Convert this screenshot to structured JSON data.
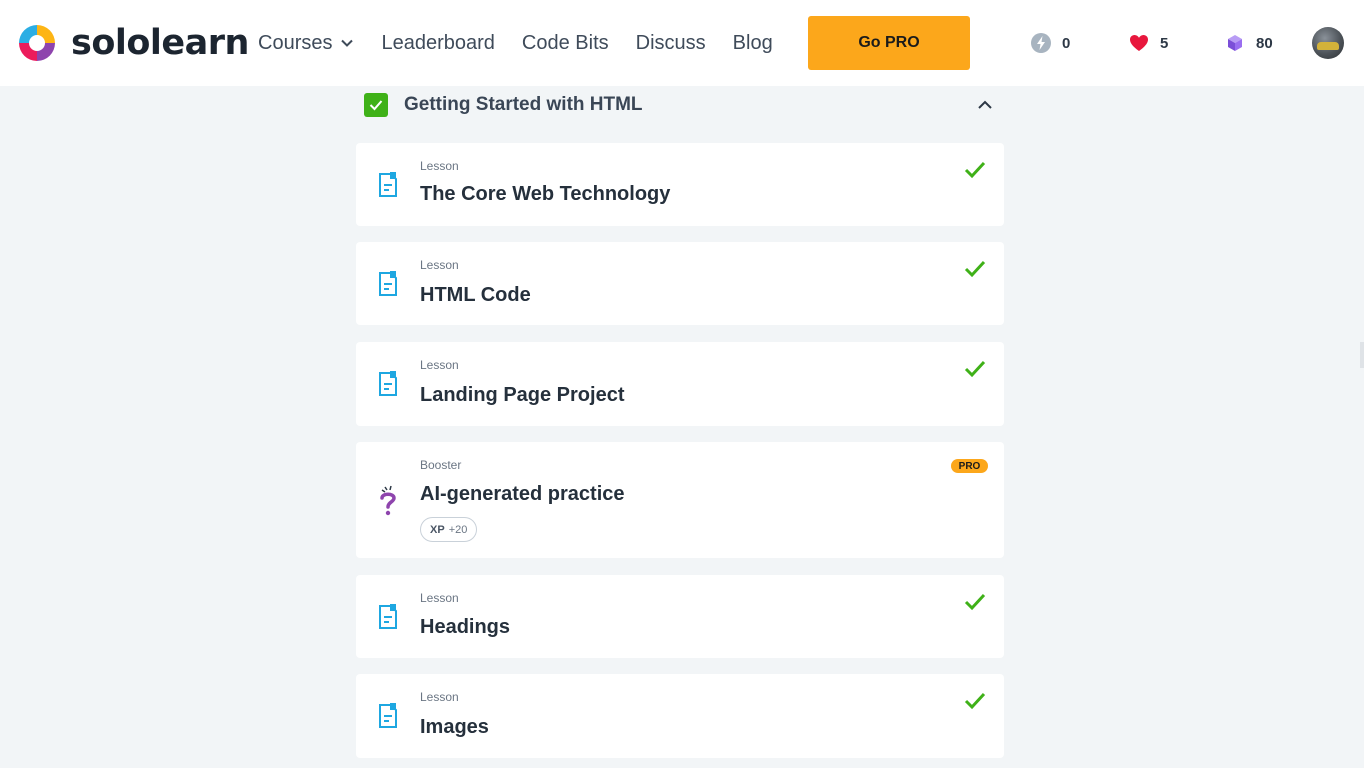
{
  "brand": {
    "name": "sololearn"
  },
  "nav": {
    "courses": "Courses",
    "leaderboard": "Leaderboard",
    "code_bits": "Code Bits",
    "discuss": "Discuss",
    "blog": "Blog"
  },
  "go_pro": "Go PRO",
  "stats": {
    "streak": "0",
    "hearts": "5",
    "gems": "80"
  },
  "module": {
    "title": "Getting Started with HTML",
    "completed": true
  },
  "items": [
    {
      "type": "Lesson",
      "title": "The Core Web Technology",
      "completed": true,
      "icon": "lesson-icon"
    },
    {
      "type": "Lesson",
      "title": "HTML Code",
      "completed": true,
      "icon": "lesson-icon"
    },
    {
      "type": "Lesson",
      "title": "Landing Page Project",
      "completed": true,
      "icon": "lesson-icon"
    },
    {
      "type": "Booster",
      "title": "AI-generated practice",
      "badge": "PRO",
      "xp_label": "XP",
      "xp_value": "+20",
      "icon": "question-mark-icon"
    },
    {
      "type": "Lesson",
      "title": "Headings",
      "completed": true,
      "icon": "lesson-icon"
    },
    {
      "type": "Lesson",
      "title": "Images",
      "completed": true,
      "icon": "lesson-icon"
    }
  ],
  "colors": {
    "accent": "#fca71b",
    "success": "#3fb118",
    "lesson_icon": "#1ea7e1",
    "background": "#f2f5f7"
  }
}
